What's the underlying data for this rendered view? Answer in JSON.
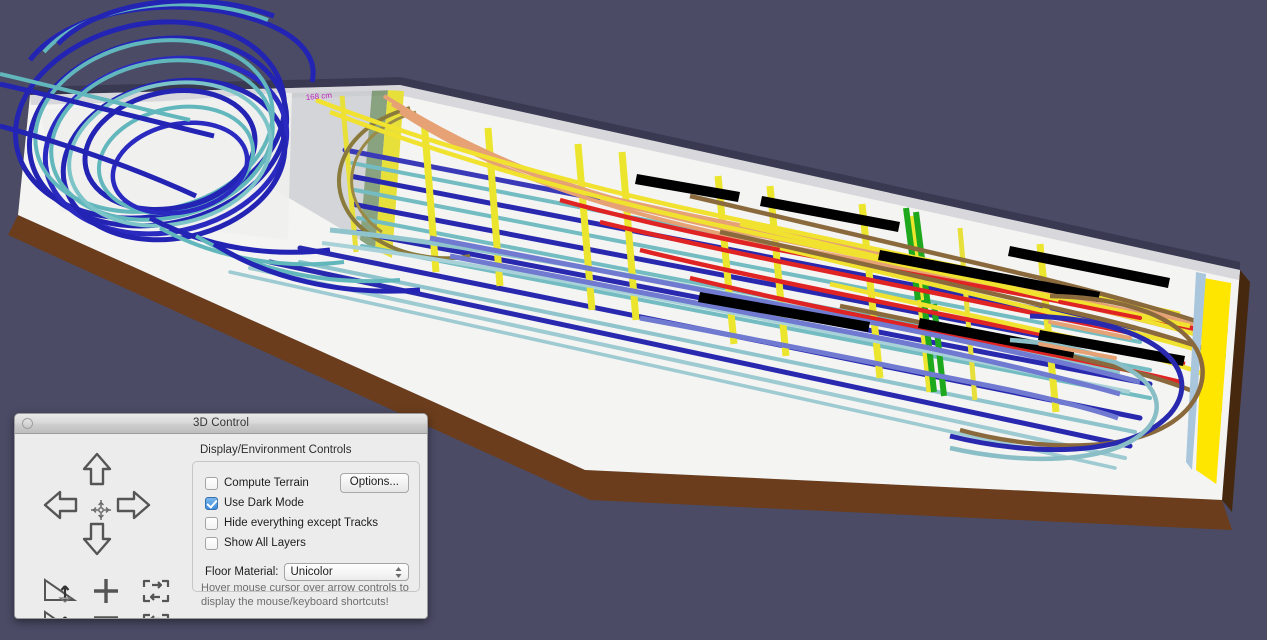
{
  "window": {
    "title": "3D Control",
    "close_button": "close-button"
  },
  "nav_pad": {
    "up": "Pan Up",
    "down": "Pan Down",
    "left": "Pan Left",
    "right": "Pan Right",
    "center": "Recenter View",
    "tilt_up": "Tilt Up",
    "tilt_down": "Tilt Down",
    "zoom_in": "+",
    "zoom_out": "−",
    "rotate_cw": "Rotate Clockwise",
    "rotate_ccw": "Rotate Counterclockwise"
  },
  "controls": {
    "group_caption": "Display/Environment Controls",
    "checkboxes": [
      {
        "label": "Compute Terrain",
        "checked": false
      },
      {
        "label": "Use Dark Mode",
        "checked": true
      },
      {
        "label": "Hide everything except Tracks",
        "checked": false
      },
      {
        "label": "Show All Layers",
        "checked": false
      }
    ],
    "options_button": "Options...",
    "floor_material_label": "Floor Material:",
    "floor_material_value": "Unicolor",
    "floor_material_options": [
      "Unicolor"
    ],
    "hint_line1": "Hover mouse cursor over arrow controls to",
    "hint_line2": "display the mouse/keyboard shortcuts!"
  },
  "viewport": {
    "scene": "3D model railroad track plan",
    "dimension_label": "168 cm",
    "colors": {
      "background": "#4b4b66",
      "baseboard_top": "#f2f2f0",
      "baseboard_edge": "#5a3318",
      "baseboard_edge_dark": "#3d2210",
      "track_blue": "#2323b4",
      "track_cyan": "#62b7bd",
      "track_yellow": "#f2e430",
      "track_bright_yellow": "#ffe600",
      "track_red": "#e02020",
      "track_orange": "#e8a070",
      "track_brown": "#7a6030",
      "track_green": "#19a819",
      "track_black": "#000000",
      "track_periwinkle": "#6f7ad0",
      "label_magenta": "#c020c0"
    }
  }
}
